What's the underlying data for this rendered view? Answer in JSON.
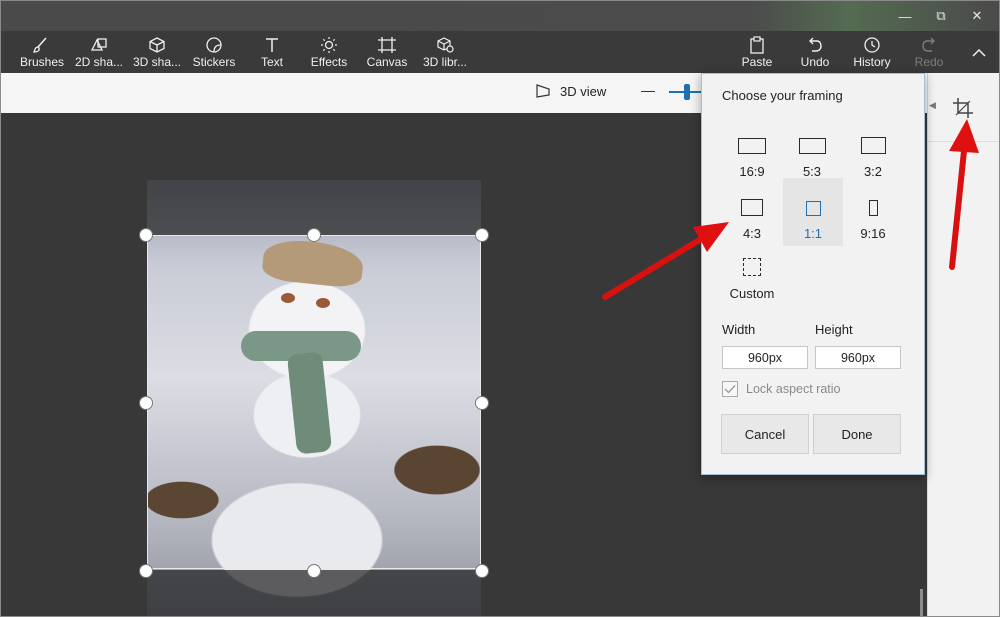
{
  "window": {
    "minimize_glyph": "—",
    "restore_glyph": "⧉",
    "close_glyph": "✕"
  },
  "toolbar": {
    "left_tools": [
      {
        "label": "Brushes",
        "icon": "brush-icon"
      },
      {
        "label": "2D sha...",
        "icon": "2d-shapes-icon"
      },
      {
        "label": "3D sha...",
        "icon": "3d-shapes-icon"
      },
      {
        "label": "Stickers",
        "icon": "sticker-icon"
      },
      {
        "label": "Text",
        "icon": "text-icon"
      },
      {
        "label": "Effects",
        "icon": "effects-icon"
      },
      {
        "label": "Canvas",
        "icon": "canvas-icon"
      },
      {
        "label": "3D libr...",
        "icon": "3d-library-icon"
      }
    ],
    "right_tools": [
      {
        "label": "Paste",
        "icon": "paste-icon"
      },
      {
        "label": "Undo",
        "icon": "undo-icon"
      },
      {
        "label": "History",
        "icon": "history-icon"
      },
      {
        "label": "Redo",
        "icon": "redo-icon",
        "disabled": true
      }
    ]
  },
  "subbar": {
    "view3d_label": "3D view",
    "zoom_minus": "—"
  },
  "framing": {
    "title": "Choose your framing",
    "ratios": [
      {
        "label": "16:9",
        "selected": false
      },
      {
        "label": "5:3",
        "selected": false
      },
      {
        "label": "3:2",
        "selected": false
      },
      {
        "label": "4:3",
        "selected": false
      },
      {
        "label": "1:1",
        "selected": true
      },
      {
        "label": "9:16",
        "selected": false
      },
      {
        "label": "Custom",
        "selected": false
      }
    ],
    "width_label": "Width",
    "height_label": "Height",
    "width_value": "960px",
    "height_value": "960px",
    "lock_label": "Lock aspect ratio",
    "lock_checked": true,
    "cancel_label": "Cancel",
    "done_label": "Done"
  },
  "colors": {
    "accent": "#1f6fb3",
    "arrow": "#e01010",
    "toolbar_bg": "#3a3a3a",
    "canvas_bg": "#383838"
  }
}
